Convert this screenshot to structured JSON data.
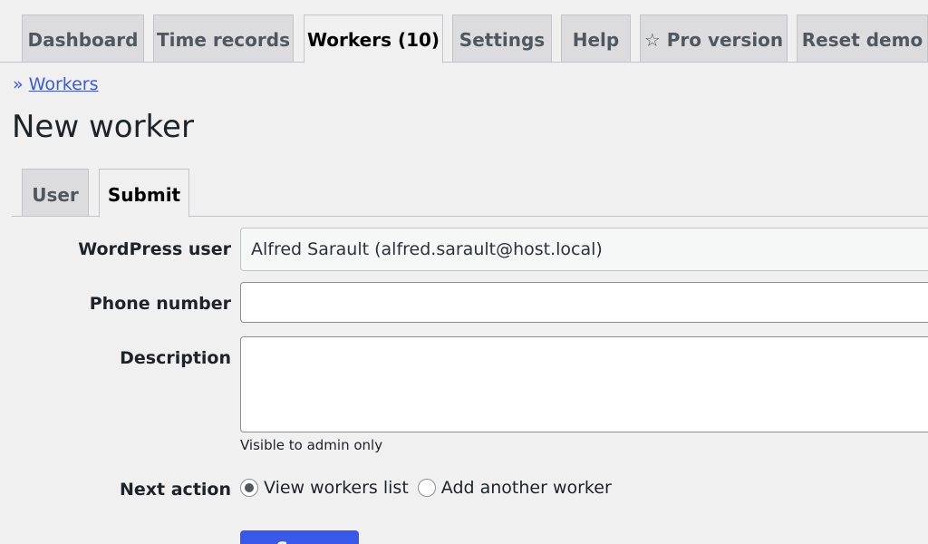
{
  "nav": {
    "tabs": [
      {
        "label": "Dashboard"
      },
      {
        "label": "Time records"
      },
      {
        "label": "Workers (10)",
        "active": true
      },
      {
        "label": "Settings"
      },
      {
        "label": "Help"
      },
      {
        "label": "☆ Pro version"
      },
      {
        "label": "Reset demo"
      }
    ]
  },
  "breadcrumb": {
    "prefix": "»",
    "link": "Workers"
  },
  "page": {
    "title": "New worker"
  },
  "sub_tabs": [
    {
      "label": "User"
    },
    {
      "label": "Submit",
      "active": true
    }
  ],
  "form": {
    "wordpress_user": {
      "label": "WordPress user",
      "value": "Alfred Sarault (alfred.sarault@host.local)"
    },
    "phone": {
      "label": "Phone number",
      "value": ""
    },
    "description": {
      "label": "Description",
      "value": "",
      "help": "Visible to admin only"
    },
    "next_action": {
      "label": "Next action",
      "options": [
        {
          "label": "View workers list",
          "checked": true
        },
        {
          "label": "Add another worker",
          "checked": false
        }
      ]
    },
    "submit_label": "Save"
  },
  "colors": {
    "accent": "#3858e9",
    "background": "#f0f0f1",
    "tab_inactive": "#dcdcde",
    "border": "#c3c4c7"
  }
}
